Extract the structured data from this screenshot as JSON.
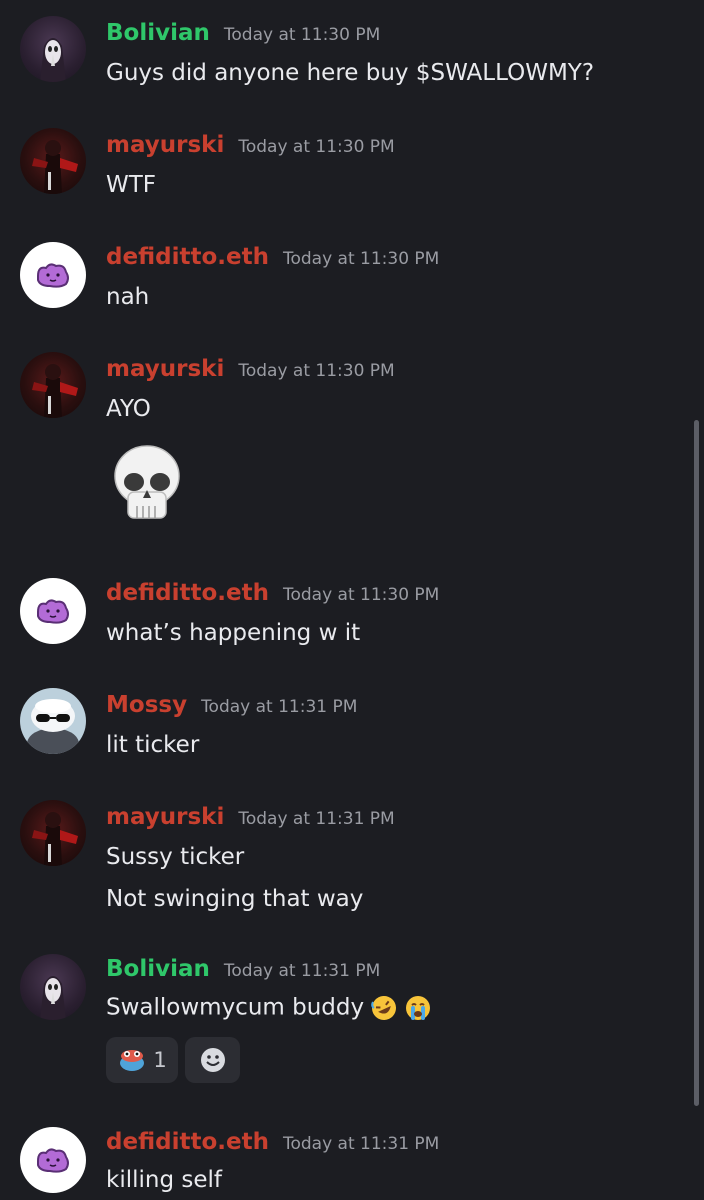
{
  "messages": [
    {
      "user": "Bolivian",
      "time": "Today at 11:30 PM",
      "lines": [
        "Guys did anyone here buy $SWALLOWMY?"
      ]
    },
    {
      "user": "mayurski",
      "time": "Today at 11:30 PM",
      "lines": [
        "WTF"
      ]
    },
    {
      "user": "defiditto.eth",
      "time": "Today at 11:30 PM",
      "lines": [
        "nah"
      ]
    },
    {
      "user": "mayurski",
      "time": "Today at 11:30 PM",
      "lines": [
        "AYO"
      ],
      "emoji": "skull-emoji"
    },
    {
      "user": "defiditto.eth",
      "time": "Today at 11:30 PM",
      "lines": [
        "what’s happening w it"
      ]
    },
    {
      "user": "Mossy",
      "time": "Today at 11:31 PM",
      "lines": [
        "lit ticker"
      ]
    },
    {
      "user": "mayurski",
      "time": "Today at 11:31 PM",
      "lines": [
        "Sussy ticker",
        "Not swinging that way"
      ]
    },
    {
      "user": "Bolivian",
      "time": "Today at 11:31 PM",
      "lines": [
        "Swallowmycum buddy"
      ],
      "inline_emojis": [
        "rofl-emoji",
        "sob-emoji"
      ],
      "reactions": [
        {
          "emoji": "frog-reaction-icon",
          "count": "1"
        }
      ],
      "add_reaction_icon": "smiley-add-reaction-icon"
    },
    {
      "user": "defiditto.eth",
      "time": "Today at 11:31 PM",
      "lines": [
        "killing self"
      ]
    }
  ],
  "colors": {
    "background": "#1c1d22",
    "green_role": "#2fc76a",
    "red_role": "#c9402f",
    "timestamp": "#9a9ca3"
  }
}
